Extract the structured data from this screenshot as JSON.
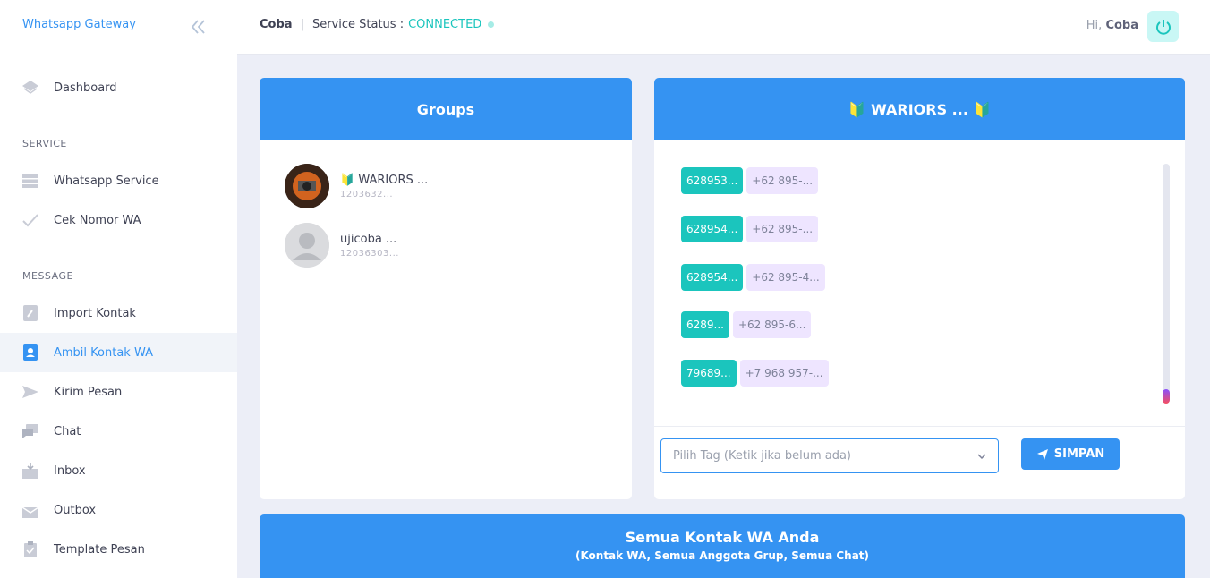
{
  "sidebar": {
    "brand": "Whatsapp Gateway",
    "sections": {
      "service": "SERVICE",
      "message": "MESSAGE"
    },
    "items": {
      "dashboard": "Dashboard",
      "whatsapp_service": "Whatsapp Service",
      "cek_nomor": "Cek Nomor WA",
      "import_kontak": "Import Kontak",
      "ambil_kontak": "Ambil Kontak WA",
      "kirim_pesan": "Kirim Pesan",
      "chat": "Chat",
      "inbox": "Inbox",
      "outbox": "Outbox",
      "template_pesan": "Template Pesan"
    },
    "active_item": "Ambil Kontak WA"
  },
  "topbar": {
    "user": "Coba",
    "separator": "|",
    "service_label": "Service Status :",
    "status": "CONNECTED",
    "greeting": "Hi,",
    "greeting_name": "Coba"
  },
  "groups_card": {
    "title": "Groups",
    "items": [
      {
        "name": "🔰 WARIORS ...",
        "id": "1203632..."
      },
      {
        "name": "ujicoba ...",
        "id": "12036303..."
      }
    ]
  },
  "detail_card": {
    "title": "🔰 WARIORS ... 🔰",
    "rows": [
      {
        "number": "628953...",
        "formatted": "+62 895-..."
      },
      {
        "number": "628954...",
        "formatted": "+62 895-..."
      },
      {
        "number": "628954...",
        "formatted": "+62 895-4..."
      },
      {
        "number": "6289...",
        "formatted": "+62 895-6..."
      },
      {
        "number": "79689...",
        "formatted": "+7 968 957-..."
      }
    ],
    "tag_placeholder": "Pilih Tag (Ketik jika belum ada)",
    "save_label": "SIMPAN"
  },
  "contacts_card": {
    "title": "Semua Kontak WA Anda",
    "subtitle": "(Kontak WA, Semua Anggota Grup, Semua Chat)"
  },
  "colors": {
    "primary": "#3593f2",
    "success": "#1bc5bd",
    "light_purple": "#eee5ff",
    "background": "#eceef7"
  }
}
